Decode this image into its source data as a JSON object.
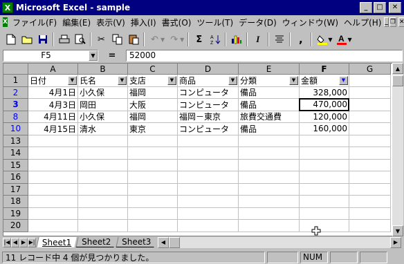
{
  "window": {
    "title": "Microsoft Excel - sample",
    "app_icon": "excel-icon"
  },
  "menu": [
    "ファイル(F)",
    "編集(E)",
    "表示(V)",
    "挿入(I)",
    "書式(O)",
    "ツール(T)",
    "データ(D)",
    "ウィンドウ(W)",
    "ヘルプ(H)"
  ],
  "toolbar": {
    "buttons": [
      "new-doc-icon",
      "open-folder-icon",
      "save-icon",
      "print-icon",
      "print-preview-icon",
      "cut-icon",
      "copy-icon",
      "paste-icon",
      "undo-icon",
      "redo-icon",
      "autosum-icon",
      "sort-ascending-icon",
      "chart-wizard-icon",
      "italic-icon",
      "align-center-icon",
      "comma-style-icon",
      "fill-color-icon",
      "font-color-icon"
    ],
    "sigma": "Σ",
    "italic": "I",
    "comma": ","
  },
  "formula_bar": {
    "name_box": "F5",
    "equals": "=",
    "value": "52000"
  },
  "columns": [
    "A",
    "B",
    "C",
    "D",
    "E",
    "F",
    "G"
  ],
  "header_row": {
    "row_label": "1",
    "cells": [
      "日付",
      "氏名",
      "支店",
      "商品",
      "分類",
      "金額",
      ""
    ]
  },
  "rows": [
    {
      "row_label": "2",
      "filtered": true,
      "cells": [
        "4月1日",
        "小久保",
        "福岡",
        "コンピュータ",
        "備品",
        "328,000",
        ""
      ]
    },
    {
      "row_label": "3",
      "filtered": true,
      "cells": [
        "4月3日",
        "岡田",
        "大阪",
        "コンピュータ",
        "備品",
        "470,000",
        ""
      ]
    },
    {
      "row_label": "8",
      "filtered": true,
      "cells": [
        "4月11日",
        "小久保",
        "福岡",
        "福岡－東京",
        "旅費交通費",
        "120,000",
        ""
      ]
    },
    {
      "row_label": "10",
      "filtered": true,
      "cells": [
        "4月15日",
        "清水",
        "東京",
        "コンピュータ",
        "備品",
        "160,000",
        ""
      ]
    },
    {
      "row_label": "13",
      "filtered": false,
      "cells": [
        "",
        "",
        "",
        "",
        "",
        "",
        ""
      ]
    },
    {
      "row_label": "14",
      "filtered": false,
      "cells": [
        "",
        "",
        "",
        "",
        "",
        "",
        ""
      ]
    },
    {
      "row_label": "15",
      "filtered": false,
      "cells": [
        "",
        "",
        "",
        "",
        "",
        "",
        ""
      ]
    },
    {
      "row_label": "16",
      "filtered": false,
      "cells": [
        "",
        "",
        "",
        "",
        "",
        "",
        ""
      ]
    },
    {
      "row_label": "17",
      "filtered": false,
      "cells": [
        "",
        "",
        "",
        "",
        "",
        "",
        ""
      ]
    },
    {
      "row_label": "18",
      "filtered": false,
      "cells": [
        "",
        "",
        "",
        "",
        "",
        "",
        ""
      ]
    },
    {
      "row_label": "19",
      "filtered": false,
      "cells": [
        "",
        "",
        "",
        "",
        "",
        "",
        ""
      ]
    },
    {
      "row_label": "20",
      "filtered": false,
      "cells": [
        "",
        "",
        "",
        "",
        "",
        "",
        ""
      ]
    }
  ],
  "sheet_tabs": [
    "Sheet1",
    "Sheet2",
    "Sheet3"
  ],
  "active_sheet": "Sheet1",
  "status": {
    "message": "11 レコード中 4 個が見つかりました。",
    "num": "NUM"
  },
  "colors": {
    "title_bar": "#000080",
    "filtered_row_label": "#0000ff",
    "chrome": "#c0c0c0"
  }
}
